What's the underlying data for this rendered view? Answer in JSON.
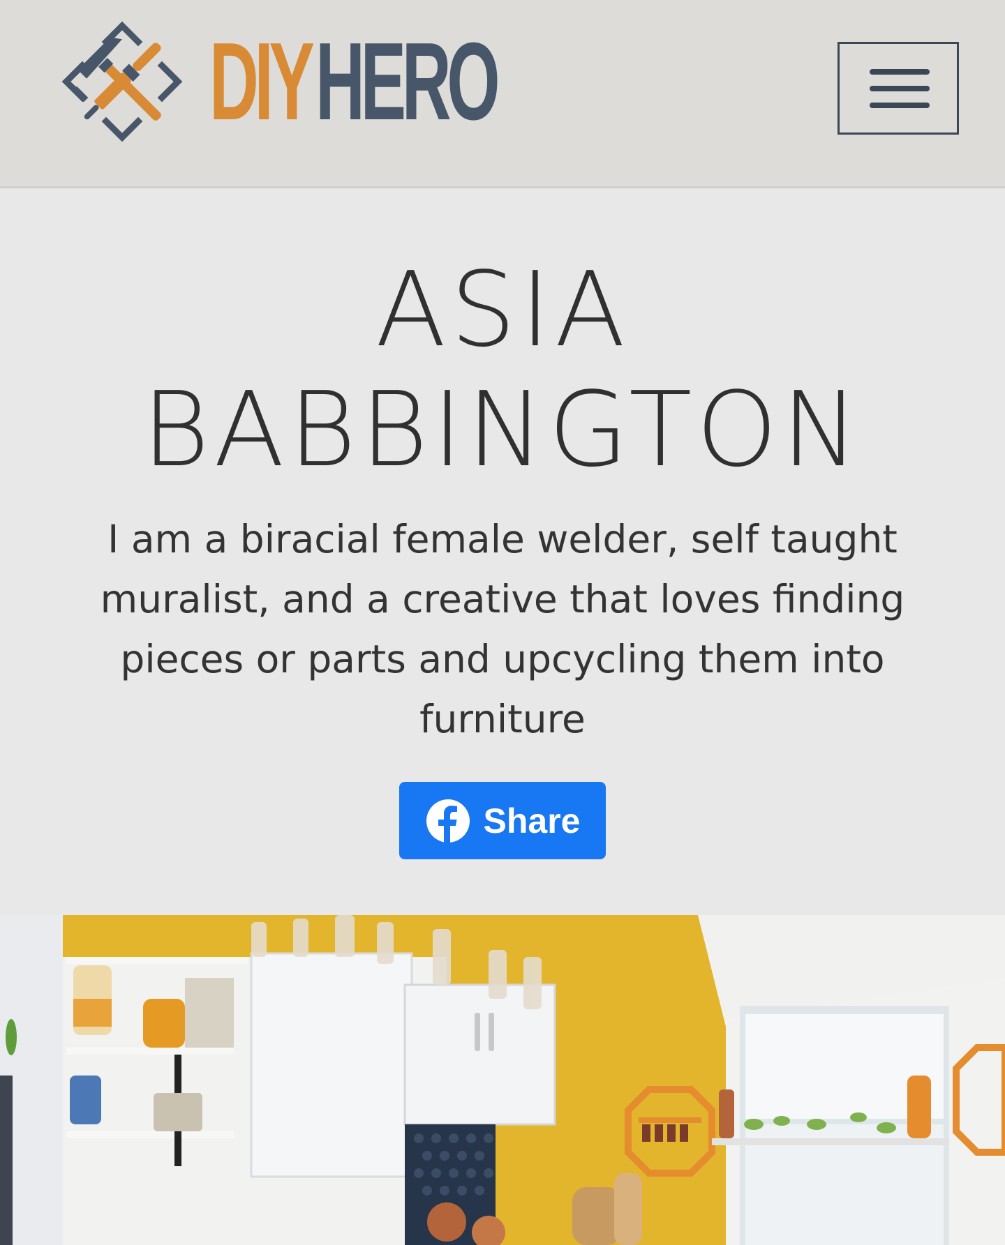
{
  "header": {
    "logo_primary": "DIY",
    "logo_secondary": "HERO",
    "menu_icon": "hamburger-menu-icon"
  },
  "profile": {
    "name_line1": "ASIA",
    "name_line2": "BABBINGTON",
    "bio": "I am a biracial female welder, self taught muralist, and a creative that loves finding pieces or parts and upcycling them into furniture"
  },
  "share": {
    "label": "Share",
    "icon": "facebook-icon"
  },
  "photo": {
    "subject": "kitchen-photo"
  },
  "colors": {
    "brand_orange": "#d88a35",
    "brand_slate": "#475669",
    "facebook_blue": "#1877f2",
    "header_bg": "#dddcd9",
    "page_bg": "#e8e8e8"
  }
}
